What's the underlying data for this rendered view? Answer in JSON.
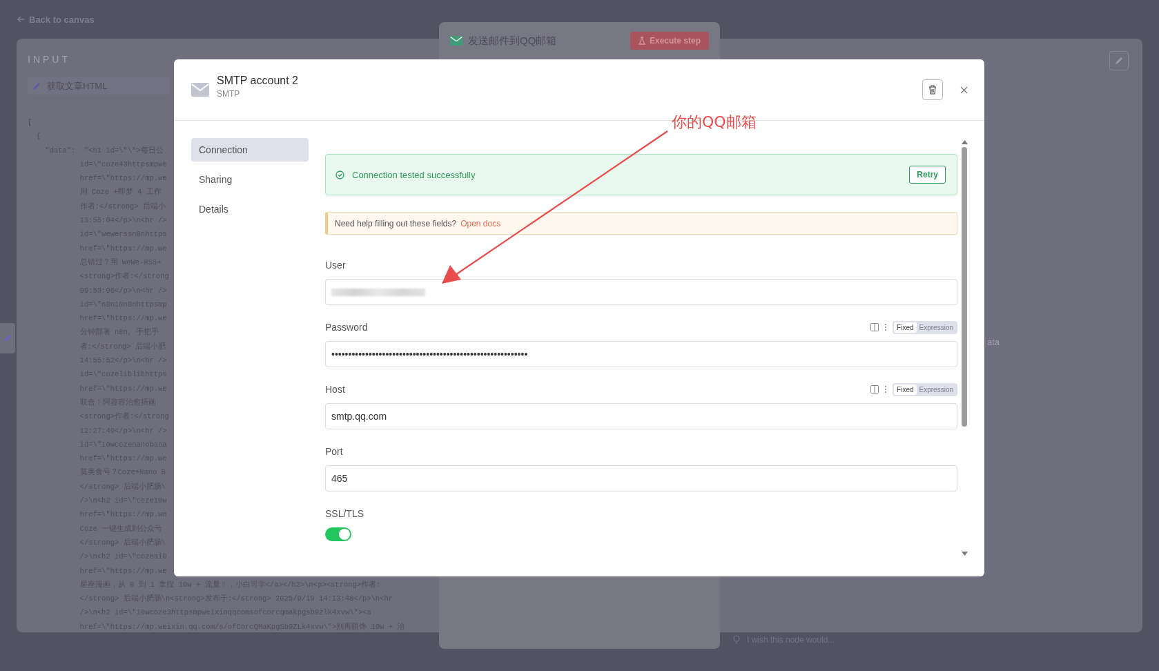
{
  "background": {
    "back_link": "Back to canvas",
    "input_panel": {
      "heading": "INPUT",
      "node_select": "获取文章HTML",
      "code_lines": [
        "[",
        "  {",
        "    \"data\":  \"<h1 id=\\\"\\\">每日公",
        "            id=\\\"coze43httpsmpwe",
        "            href=\\\"https://mp.we",
        "            用 Coze +即梦 4 工作",
        "            作者:</strong> 后端小",
        "            13:55:04</p>\\n<hr />",
        "            id=\\\"wewerssn8nhttps",
        "            href=\\\"https://mp.we",
        "            总错过？用 WeWe-RSS+",
        "            <strong>作者:</strong",
        "            09:53:06</p>\\n<hr />",
        "            id=\\\"n8n10n8nhttpsmp",
        "            href=\\\"https://mp.we",
        "            分钟部署 n8n, 手把手",
        "            者:</strong> 后端小肥",
        "            14:55:52</p>\\n<hr />",
        "            id=\\\"cozeliblibhttps",
        "            href=\\\"https://mp.we",
        "            联合！阿容容治愈插画",
        "            <strong>作者:</strong",
        "            12:27:49</p>\\n<hr />",
        "            id=\\\"10wcozenanobana",
        "            href=\\\"https://mp.we",
        "            莫美食号？Coze+Nano B",
        "            </strong> 后端小肥肠\\",
        "            />\\n<h2 id=\\\"coze10w",
        "            href=\\\"https://mp.we",
        "            Coze 一键生成到公众号",
        "            </strong> 后端小肥肠\\",
        "            />\\n<h2 id=\\\"cozeai0",
        "            href=\\\"https://mp.we",
        "            星座漫画，从 0 到 1 拿捏 10w + 流量！，小白可学</a></h2>\\n<p><strong>作者:",
        "            </strong> 后端小肥肠\\n<strong>发布于:</strong> 2025/9/19 14:13:48</p>\\n<hr",
        "            />\\n<h2 id=\\\"10wcoze3httpsmpweixinqqcomsofcorcqmakpgsb9zlk4xvw\\\"><a",
        "            href=\\\"https://mp.weixin.qq.com/s/ofCorcQMaKpgSb9ZLk4xvw\\\">别再眼馋 10w + 治"
      ]
    },
    "output_fragment": "ata",
    "node": {
      "title": "发送邮件到QQ邮箱",
      "execute_button": "Execute step"
    },
    "feedback_placeholder": "I wish this node would..."
  },
  "modal": {
    "title": "SMTP account 2",
    "subtitle": "SMTP",
    "nav": [
      {
        "label": "Connection",
        "selected": true
      },
      {
        "label": "Sharing",
        "selected": false
      },
      {
        "label": "Details",
        "selected": false
      }
    ],
    "status": {
      "text": "Connection tested successfully",
      "button": "Retry"
    },
    "help": {
      "text": "Need help filling out these fields?",
      "link": "Open docs"
    },
    "fields": [
      {
        "kind": "text",
        "label": "User",
        "redacted": true
      },
      {
        "kind": "text",
        "label": "Password",
        "value": "••••••••••••••••••••••••••••••••••••••••••••••••••••••••••",
        "mode_options": [
          {
            "label": "Fixed",
            "selected": true
          },
          {
            "label": "Expression",
            "selected": false
          }
        ]
      },
      {
        "kind": "text",
        "label": "Host",
        "value": "smtp.qq.com",
        "mode_options": [
          {
            "label": "Fixed",
            "selected": true
          },
          {
            "label": "Expression",
            "selected": false
          }
        ]
      },
      {
        "kind": "text",
        "label": "Port",
        "value": "465"
      },
      {
        "kind": "switch",
        "label": "SSL/TLS",
        "on": true
      }
    ]
  },
  "annotation": {
    "text": "你的QQ邮箱"
  }
}
